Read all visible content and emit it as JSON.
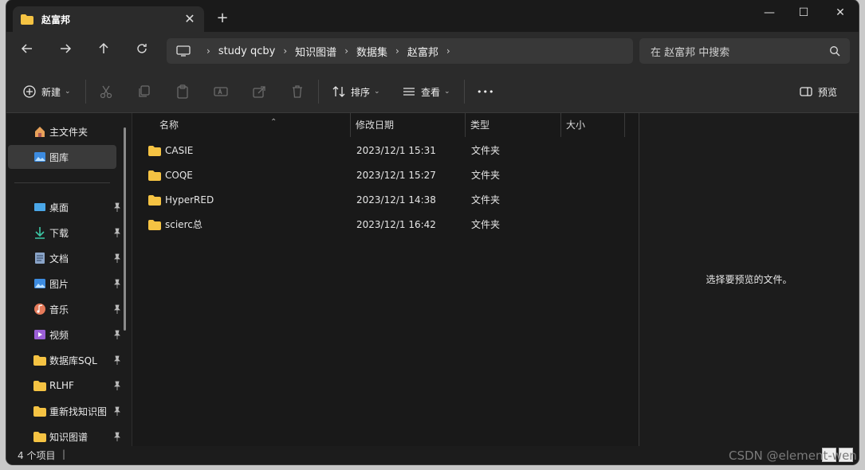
{
  "window": {
    "tab_title": "赵富邦",
    "new_tab": "+",
    "close_tab": "✕",
    "minimize": "—",
    "maximize": "☐",
    "close": "✕"
  },
  "address": {
    "breadcrumbs": [
      "study qcby",
      "知识图谱",
      "数据集",
      "赵富邦"
    ],
    "search_placeholder": "在 赵富邦 中搜索"
  },
  "toolbar": {
    "new_label": "新建",
    "sort_label": "排序",
    "view_label": "查看",
    "more_label": "•••",
    "preview_label": "预览"
  },
  "sidebar": {
    "items": [
      {
        "label": "主文件夹",
        "icon": "home-icon"
      },
      {
        "label": "图库",
        "icon": "gallery-icon"
      },
      {
        "label": "桌面",
        "icon": "desktop-icon"
      },
      {
        "label": "下载",
        "icon": "download-icon"
      },
      {
        "label": "文档",
        "icon": "document-icon"
      },
      {
        "label": "图片",
        "icon": "pictures-icon"
      },
      {
        "label": "音乐",
        "icon": "music-icon"
      },
      {
        "label": "视频",
        "icon": "video-icon"
      },
      {
        "label": "数据库SQL",
        "icon": "folder-icon"
      },
      {
        "label": "RLHF",
        "icon": "folder-icon"
      },
      {
        "label": "重新找知识图",
        "icon": "folder-icon"
      },
      {
        "label": "知识图谱",
        "icon": "folder-icon"
      }
    ]
  },
  "filelist": {
    "columns": [
      "名称",
      "修改日期",
      "类型",
      "大小"
    ],
    "rows": [
      {
        "name": "CASIE",
        "date": "2023/12/1 15:31",
        "type": "文件夹",
        "size": ""
      },
      {
        "name": "COQE",
        "date": "2023/12/1 15:27",
        "type": "文件夹",
        "size": ""
      },
      {
        "name": "HyperRED",
        "date": "2023/12/1 14:38",
        "type": "文件夹",
        "size": ""
      },
      {
        "name": "scierc总",
        "date": "2023/12/1 16:42",
        "type": "文件夹",
        "size": ""
      }
    ]
  },
  "preview": {
    "message": "选择要预览的文件。"
  },
  "status": {
    "item_count": "4 个项目",
    "separator": "|"
  },
  "watermark": "CSDN @element-wen",
  "colors": {
    "folder": "#f5c343",
    "background": "#1c1c1c",
    "panel": "#2b2b2b"
  }
}
